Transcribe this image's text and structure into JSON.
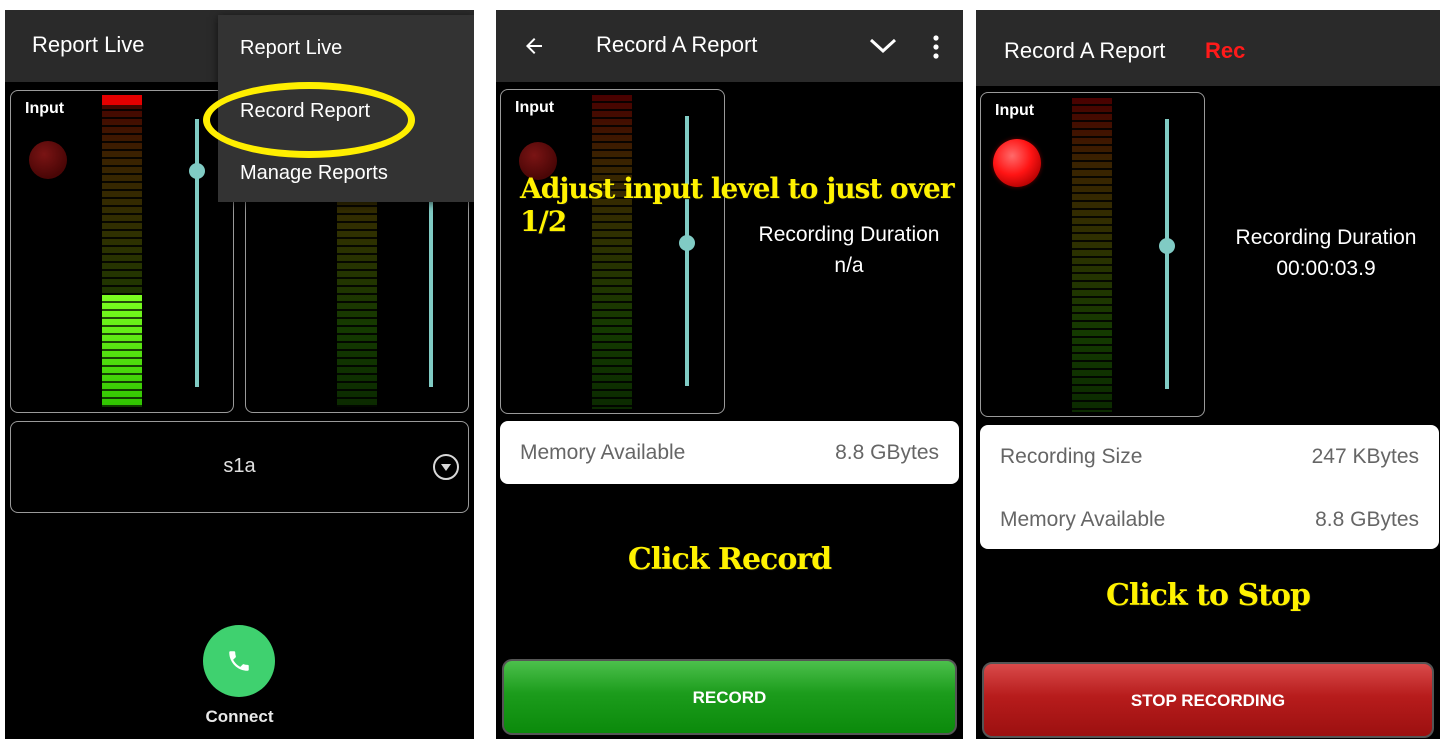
{
  "screen1": {
    "title": "Report Live",
    "meter_label": "Input",
    "meter_level": 0.36,
    "menu": {
      "items": [
        "Report Live",
        "Record Report",
        "Manage Reports"
      ],
      "highlighted": "Record Report"
    },
    "dropdown_value": "s1a",
    "connect_label": "Connect",
    "accent_color": "#80cbc4",
    "call_color": "#3fd16f"
  },
  "screen2": {
    "title": "Record A Report",
    "meter_label": "Input",
    "duration_label": "Recording Duration",
    "duration_value": "n/a",
    "memory_label": "Memory Available",
    "memory_value": "8.8  GBytes",
    "annotation_top": "Adjust input level to just over 1/2",
    "annotation_mid": "Click Record",
    "button_label": "RECORD"
  },
  "screen3": {
    "title": "Record A Report",
    "rec_badge": "Rec",
    "meter_label": "Input",
    "duration_label": "Recording Duration",
    "duration_value": "00:00:03.9",
    "size_label": "Recording Size",
    "size_value": "247 KBytes",
    "memory_label": "Memory Available",
    "memory_value": "8.8  GBytes",
    "annotation": "Click to Stop",
    "button_label": "STOP RECORDING"
  },
  "colors": {
    "annotation": "#fff200",
    "rec_badge": "#ff1a1a",
    "record_button": "#1c9c1c",
    "stop_button": "#b71c1c"
  }
}
